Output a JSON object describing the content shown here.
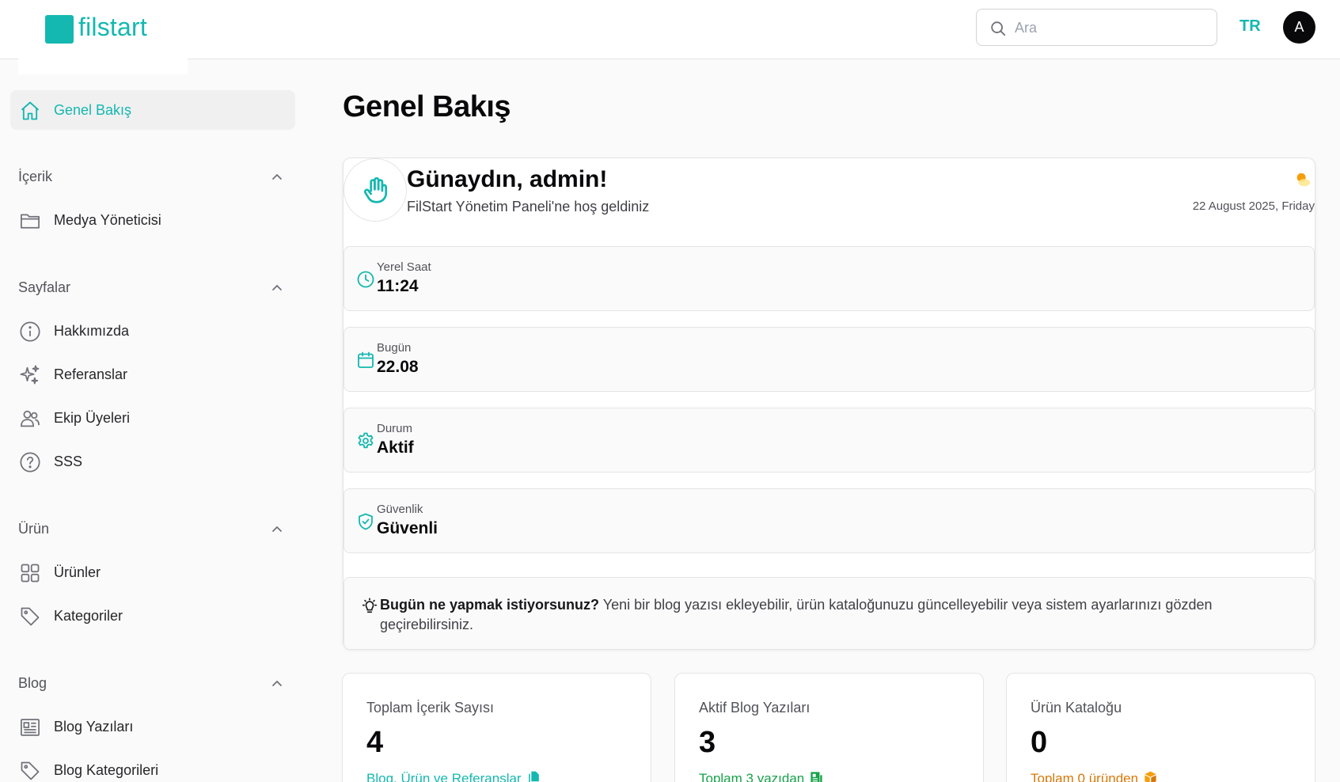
{
  "brand": {
    "name": "filstart",
    "color": "#14b8b0"
  },
  "search": {
    "placeholder": "Ara"
  },
  "header": {
    "language": "TR",
    "avatar_initial": "A"
  },
  "sidebar": {
    "home": {
      "label": "Genel Bakış",
      "icon": "home-icon"
    },
    "groups": [
      {
        "title": "İçerik",
        "items": [
          {
            "label": "Medya Yöneticisi",
            "icon": "folder-icon"
          }
        ]
      },
      {
        "title": "Sayfalar",
        "items": [
          {
            "label": "Hakkımızda",
            "icon": "info-icon"
          },
          {
            "label": "Referanslar",
            "icon": "sparkles-icon"
          },
          {
            "label": "Ekip Üyeleri",
            "icon": "users-icon"
          },
          {
            "label": "SSS",
            "icon": "question-icon"
          }
        ]
      },
      {
        "title": "Ürün",
        "items": [
          {
            "label": "Ürünler",
            "icon": "grid-icon"
          },
          {
            "label": "Kategoriler",
            "icon": "tag-icon"
          }
        ]
      },
      {
        "title": "Blog",
        "items": [
          {
            "label": "Blog Yazıları",
            "icon": "newspaper-icon"
          },
          {
            "label": "Blog Kategorileri",
            "icon": "tag-icon"
          }
        ]
      }
    ]
  },
  "main": {
    "title": "Genel Bakış",
    "welcome": {
      "greeting": "Günaydın, admin!",
      "subtitle": "FilStart Yönetim Paneli'ne hoş geldiniz",
      "date": "22 August 2025, Friday",
      "stats": [
        {
          "label": "Yerel Saat",
          "value": "11:24",
          "icon": "clock-icon"
        },
        {
          "label": "Bugün",
          "value": "22.08",
          "icon": "calendar-icon"
        },
        {
          "label": "Durum",
          "value": "Aktif",
          "icon": "gear-icon"
        },
        {
          "label": "Güvenlik",
          "value": "Güvenli",
          "icon": "shield-check-icon"
        }
      ],
      "tip_bold": "Bugün ne yapmak istiyorsunuz?",
      "tip_text": " Yeni bir blog yazısı ekleyebilir, ürün kataloğunuzu güncelleyebilir veya sistem ayarlarınızı gözden geçirebilirsiniz."
    },
    "cards": [
      {
        "label": "Toplam İçerik Sayısı",
        "value": "4",
        "desc": "Blog, Ürün ve Referanslar",
        "desc_color": "#14b8b0",
        "icon": "documents-icon"
      },
      {
        "label": "Aktif Blog Yazıları",
        "value": "3",
        "desc": "Toplam 3 yazıdan",
        "desc_color": "#16a34a",
        "icon": "newspaper-icon"
      },
      {
        "label": "Ürün Kataloğu",
        "value": "0",
        "desc": "Toplam 0 üründen",
        "desc_color": "#d97706",
        "icon": "cube-icon"
      }
    ]
  }
}
